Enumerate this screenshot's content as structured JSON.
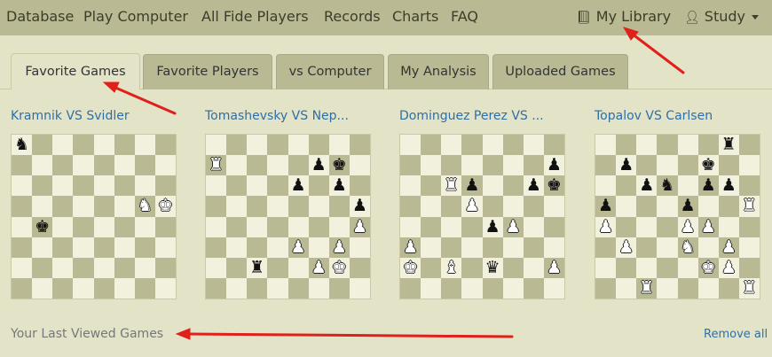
{
  "nav": {
    "database": "Database",
    "play_computer": "Play Computer",
    "all_fide_players": "All Fide Players",
    "records": "Records",
    "charts": "Charts",
    "faq": "FAQ",
    "my_library": "My Library",
    "study": "Study"
  },
  "tabs": [
    "Favorite Games",
    "Favorite Players",
    "vs Computer",
    "My Analysis",
    "Uploaded Games"
  ],
  "active_tab": "Favorite Games",
  "games": [
    {
      "title": "Kramnik VS Svidler",
      "pieces": [
        {
          "sq": "a8",
          "c": "b",
          "p": "n"
        },
        {
          "sq": "g5",
          "c": "w",
          "p": "n"
        },
        {
          "sq": "h5",
          "c": "w",
          "p": "k"
        },
        {
          "sq": "b4",
          "c": "b",
          "p": "k"
        }
      ]
    },
    {
      "title": "Tomashevsky VS Nep...",
      "pieces": [
        {
          "sq": "a7",
          "c": "w",
          "p": "r"
        },
        {
          "sq": "f7",
          "c": "b",
          "p": "p"
        },
        {
          "sq": "g7",
          "c": "b",
          "p": "k"
        },
        {
          "sq": "e6",
          "c": "b",
          "p": "p"
        },
        {
          "sq": "g6",
          "c": "b",
          "p": "p"
        },
        {
          "sq": "h5",
          "c": "b",
          "p": "p"
        },
        {
          "sq": "h4",
          "c": "w",
          "p": "p"
        },
        {
          "sq": "e3",
          "c": "w",
          "p": "p"
        },
        {
          "sq": "g3",
          "c": "w",
          "p": "p"
        },
        {
          "sq": "c2",
          "c": "b",
          "p": "r"
        },
        {
          "sq": "f2",
          "c": "w",
          "p": "p"
        },
        {
          "sq": "g2",
          "c": "w",
          "p": "k"
        }
      ]
    },
    {
      "title": "Dominguez Perez VS ...",
      "pieces": [
        {
          "sq": "h7",
          "c": "b",
          "p": "p"
        },
        {
          "sq": "c6",
          "c": "w",
          "p": "r"
        },
        {
          "sq": "d6",
          "c": "b",
          "p": "p"
        },
        {
          "sq": "g6",
          "c": "b",
          "p": "p"
        },
        {
          "sq": "h6",
          "c": "b",
          "p": "k"
        },
        {
          "sq": "d5",
          "c": "w",
          "p": "p"
        },
        {
          "sq": "e4",
          "c": "b",
          "p": "p"
        },
        {
          "sq": "f4",
          "c": "w",
          "p": "p"
        },
        {
          "sq": "a3",
          "c": "w",
          "p": "p"
        },
        {
          "sq": "a2",
          "c": "w",
          "p": "k"
        },
        {
          "sq": "c2",
          "c": "w",
          "p": "b"
        },
        {
          "sq": "e2",
          "c": "b",
          "p": "q"
        },
        {
          "sq": "h2",
          "c": "w",
          "p": "p"
        }
      ]
    },
    {
      "title": "Topalov VS Carlsen",
      "pieces": [
        {
          "sq": "g8",
          "c": "b",
          "p": "r"
        },
        {
          "sq": "b7",
          "c": "b",
          "p": "p"
        },
        {
          "sq": "f7",
          "c": "b",
          "p": "k"
        },
        {
          "sq": "c6",
          "c": "b",
          "p": "p"
        },
        {
          "sq": "d6",
          "c": "b",
          "p": "n"
        },
        {
          "sq": "f6",
          "c": "b",
          "p": "p"
        },
        {
          "sq": "g6",
          "c": "b",
          "p": "p"
        },
        {
          "sq": "a5",
          "c": "b",
          "p": "p"
        },
        {
          "sq": "e5",
          "c": "b",
          "p": "p"
        },
        {
          "sq": "h5",
          "c": "w",
          "p": "r"
        },
        {
          "sq": "a4",
          "c": "w",
          "p": "p"
        },
        {
          "sq": "e4",
          "c": "w",
          "p": "p"
        },
        {
          "sq": "f4",
          "c": "w",
          "p": "p"
        },
        {
          "sq": "b3",
          "c": "w",
          "p": "p"
        },
        {
          "sq": "e3",
          "c": "w",
          "p": "n"
        },
        {
          "sq": "g3",
          "c": "w",
          "p": "p"
        },
        {
          "sq": "f2",
          "c": "w",
          "p": "k"
        },
        {
          "sq": "g2",
          "c": "w",
          "p": "p"
        },
        {
          "sq": "c1",
          "c": "w",
          "p": "r"
        },
        {
          "sq": "h1",
          "c": "w",
          "p": "r"
        }
      ]
    }
  ],
  "last_viewed": "Your Last Viewed Games",
  "remove_all": "Remove all",
  "colors": {
    "navbar": "#b9b994",
    "background": "#e3e3c8",
    "light_square": "#f1f1dd",
    "dark_square": "#b9b994",
    "link": "#2f6fa7",
    "arrow": "#e0201a"
  }
}
